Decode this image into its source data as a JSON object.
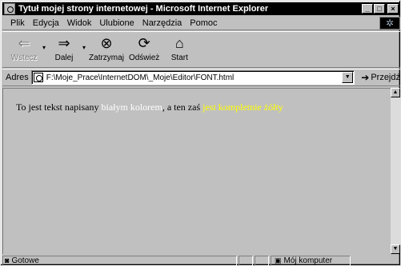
{
  "window": {
    "title": "Tytuł mojej strony internetowej - Microsoft Internet Explorer",
    "minimize": "_",
    "maximize": "□",
    "close": "×"
  },
  "menu": {
    "items": [
      "Plik",
      "Edycja",
      "Widok",
      "Ulubione",
      "Narzędzia",
      "Pomoc"
    ]
  },
  "toolbar": {
    "back": "Wstecz",
    "forward": "Dalej",
    "stop": "Zatrzymaj",
    "refresh": "Odśwież",
    "home": "Start"
  },
  "address": {
    "label": "Adres",
    "url": "F:\\Moje_Prace\\InternetDOM\\_Moje\\Editor\\FONT.html",
    "go": "Przejdź"
  },
  "content": {
    "text_before": "To jest tekst napisany ",
    "white_text": "białym kolorem",
    "text_middle": ", a ten zaś ",
    "yellow_text": "jest kompletnie żółty",
    "white_color": "#ffffff",
    "yellow_color": "#ffff00"
  },
  "status": {
    "text": "Gotowe",
    "zone": "Mój komputer"
  }
}
